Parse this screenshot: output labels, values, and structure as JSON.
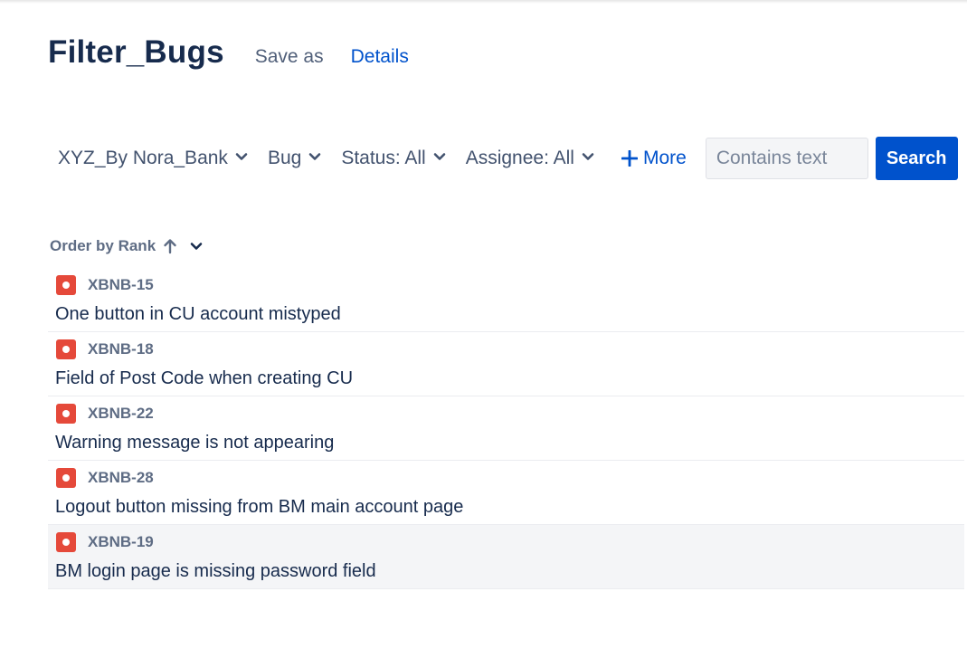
{
  "header": {
    "title": "Filter_Bugs",
    "save_as": "Save as",
    "details": "Details"
  },
  "filters": {
    "project": "XYZ_By Nora_Bank",
    "type": "Bug",
    "status": "Status: All",
    "assignee": "Assignee: All",
    "more": "More",
    "search_placeholder": "Contains text",
    "search_button": "Search"
  },
  "order": {
    "label": "Order by Rank"
  },
  "issues": [
    {
      "key": "XBNB-15",
      "summary": "One button in CU account mistyped",
      "icon": "bug-icon"
    },
    {
      "key": "XBNB-18",
      "summary": "Field of Post Code when creating CU",
      "icon": "bug-icon"
    },
    {
      "key": "XBNB-22",
      "summary": "Warning message is not appearing",
      "icon": "bug-icon"
    },
    {
      "key": "XBNB-28",
      "summary": "Logout button missing from BM main account page",
      "icon": "bug-icon"
    },
    {
      "key": "XBNB-19",
      "summary": "BM login page is missing password field",
      "icon": "bug-icon",
      "selected": true
    }
  ],
  "colors": {
    "accent": "#0052cc",
    "bug": "#e5493a",
    "text": "#172b4d",
    "muted": "#5e6c84"
  }
}
